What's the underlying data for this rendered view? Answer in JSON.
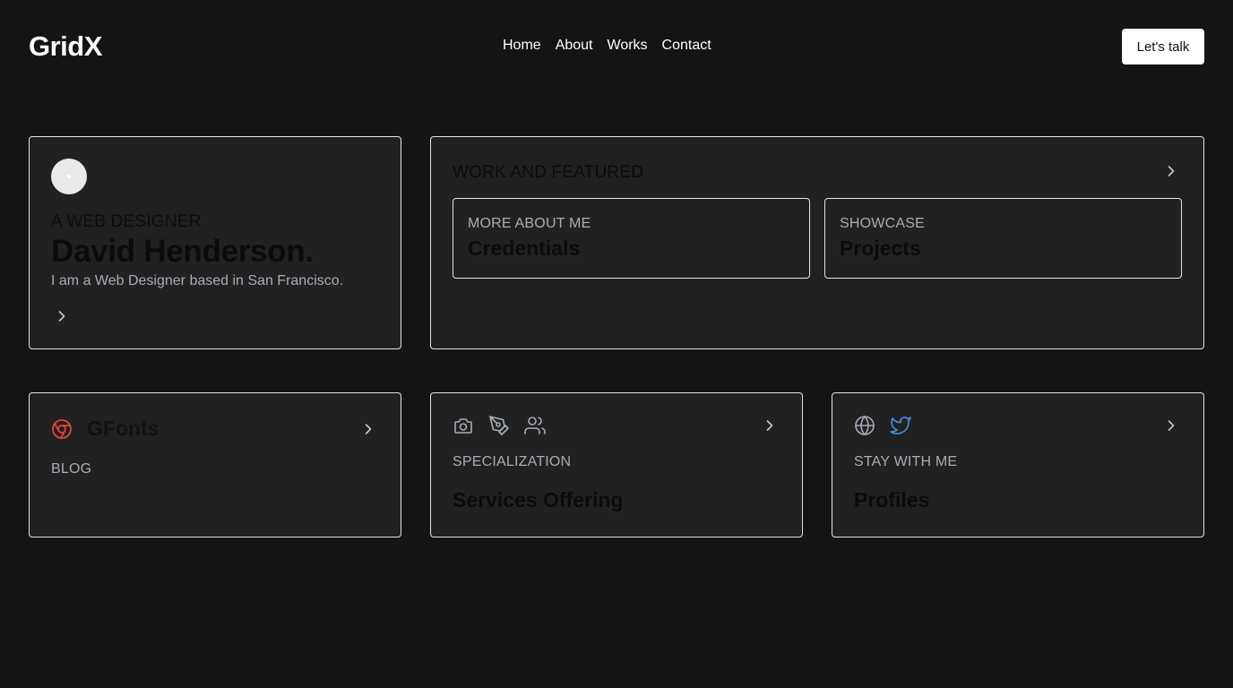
{
  "header": {
    "logo": "GridX",
    "nav": [
      "Home",
      "About",
      "Works",
      "Contact"
    ],
    "cta_label": "Let's talk"
  },
  "profile_card": {
    "eyebrow": "A WEB DESIGNER",
    "name": "David Henderson.",
    "bio": "I am a Web Designer based in San Francisco.",
    "avatar_icon": "avatar",
    "arrow_icon": "chevron-right-icon"
  },
  "work_card": {
    "title": "WORK AND FEATURED",
    "arrow_icon": "chevron-right-icon",
    "items": [
      {
        "eyebrow": "MORE ABOUT ME",
        "title": "Credentials"
      },
      {
        "eyebrow": "SHOWCASE",
        "title": "Projects"
      }
    ]
  },
  "gfonts_card": {
    "title": "GFonts",
    "subtitle": "BLOG",
    "icon": "chrome-icon",
    "arrow_icon": "chevron-right-icon"
  },
  "services_card": {
    "icons": [
      "camera-icon",
      "pen-tool-icon",
      "users-icon"
    ],
    "eyebrow": "SPECIALIZATION",
    "title": "Services Offering",
    "arrow_icon": "chevron-right-icon"
  },
  "profiles_card": {
    "icons": [
      "globe-icon",
      "twitter-icon"
    ],
    "eyebrow": "STAY WITH ME",
    "title": "Profiles",
    "arrow_icon": "chevron-right-icon"
  },
  "colors": {
    "background": "#141414",
    "card": "#212121",
    "card_border": "#e6e6e6",
    "muted_text": "#a7adb8",
    "chrome_red": "#e0443a",
    "twitter_blue": "#4a8fe0"
  }
}
